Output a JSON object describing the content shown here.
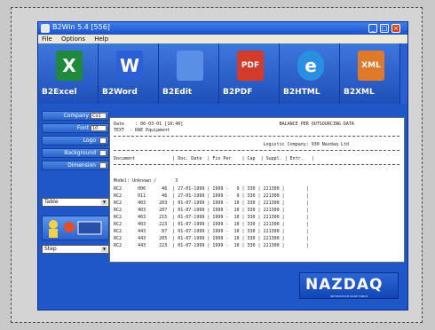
{
  "window": {
    "title": "B2Win 5.4 [556]",
    "menu": [
      "File",
      "Options",
      "Help"
    ]
  },
  "toolbar": {
    "items": [
      {
        "label": "B2Excel",
        "glyph": "X",
        "icon": "excel-icon",
        "color": "#1e8a3c"
      },
      {
        "label": "B2Word",
        "glyph": "W",
        "icon": "word-icon",
        "color": "#2b5fd8"
      },
      {
        "label": "B2Edit",
        "glyph": "",
        "icon": "edit-icon",
        "color": "#5b8fe6"
      },
      {
        "label": "B2PDF",
        "glyph": "PDF",
        "icon": "pdf-icon",
        "color": "#d43b2a"
      },
      {
        "label": "B2HTML",
        "glyph": "e",
        "icon": "html-icon",
        "color": "#2a8fe0"
      },
      {
        "label": "B2XML",
        "glyph": "XML",
        "icon": "xml-icon",
        "color": "#e07a2a"
      }
    ]
  },
  "sidebar": {
    "company": {
      "label": "Company",
      "value": "Co1"
    },
    "font": {
      "label": "Font",
      "value": "10"
    },
    "logo": {
      "label": "Logo"
    },
    "background": {
      "label": "Background"
    },
    "dimension": {
      "label": "Dimension"
    },
    "select1": {
      "value": "Table"
    },
    "select2": {
      "value": "Step"
    }
  },
  "document": {
    "lines": [
      "Date    : 06-03-01 [10:40]                                    BALANCE PER OUTSOURCING DATA",
      "TEXT  - RAE Equipment",
      "                                                        Logistic Company: 930 Nazdaq Ltd",
      "Document              | Doc. Date  | Fin Per    | Cap  | Suppl. | Entr.   |",
      "Model: Unknown /       3",
      "RC2      006      46  | 27-01-1999 | 1999 -   9 | 330 | 221300 |        |",
      "RC2      011      46  | 27-01-1999 | 1999 -   9 | 330 | 221300 |        |",
      "RC2      403     203  | 01-07-1999 | 1999 -  10 | 330 | 221300 |        |",
      "RC2      403     207  | 01-07-1999 | 1999 -  10 | 330 | 221300 |        |",
      "RC2      403     215  | 01-07-1999 | 1999 -  10 | 330 | 221300 |        |",
      "RC2      403     223  | 01-07-1999 | 1999 -  10 | 330 | 221300 |        |",
      "RC2      443      87  | 01-07-1999 | 1999 -  10 | 330 | 221300 |        |",
      "RC2      443     205  | 01-07-1999 | 1999 -  10 | 330 | 221300 |        |",
      "RC2      443     223  | 01-07-1999 | 1999 -  10 | 330 | 221300 |        |"
    ]
  },
  "brand": {
    "name": "NAZDAQ",
    "tagline": "INFORMATION MADE SIMPLE"
  }
}
